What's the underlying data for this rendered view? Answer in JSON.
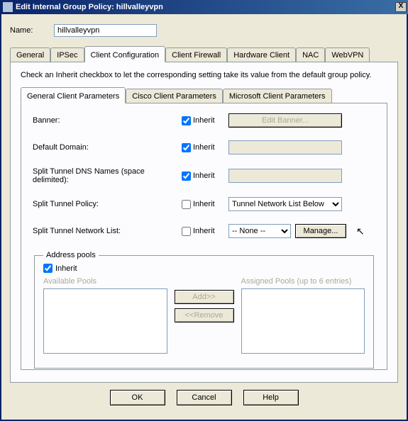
{
  "window": {
    "title": "Edit Internal Group Policy: hillvalleyvpn"
  },
  "name": {
    "label": "Name:",
    "value": "hillvalleyvpn"
  },
  "tabs": {
    "general": "General",
    "ipsec": "IPSec",
    "client_config": "Client Configuration",
    "client_firewall": "Client Firewall",
    "hardware_client": "Hardware Client",
    "nac": "NAC",
    "webvpn": "WebVPN"
  },
  "instruction": "Check an Inherit checkbox to let the corresponding setting take its value from the default group policy.",
  "subtabs": {
    "gcp": "General Client Parameters",
    "ccp": "Cisco Client Parameters",
    "mcp": "Microsoft Client Parameters"
  },
  "inherit_label": "Inherit",
  "rows": {
    "banner": {
      "label": "Banner:",
      "btn": "Edit Banner..."
    },
    "default_domain": {
      "label": "Default Domain:"
    },
    "split_dns": {
      "label": "Split Tunnel DNS Names (space delimited):"
    },
    "split_policy": {
      "label": "Split Tunnel Policy:",
      "value": "Tunnel Network List Below"
    },
    "split_list": {
      "label": "Split Tunnel Network List:",
      "value": "-- None --",
      "manage": "Manage..."
    }
  },
  "pools": {
    "legend": "Address pools",
    "available": "Available Pools",
    "assigned": "Assigned Pools (up to 6 entries)",
    "add": "Add>>",
    "remove": "<<Remove"
  },
  "buttons": {
    "ok": "OK",
    "cancel": "Cancel",
    "help": "Help"
  }
}
